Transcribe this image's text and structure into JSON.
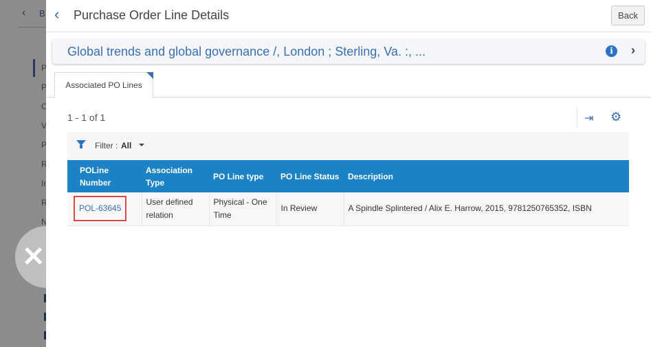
{
  "background": {
    "back_label": "B",
    "letters": [
      "P",
      "P",
      "C",
      "V",
      "P",
      "R",
      "In",
      "R",
      "N"
    ]
  },
  "close_overlay": {
    "glyph": "✕"
  },
  "header": {
    "title": "Purchase Order Line Details",
    "back_button": "Back"
  },
  "record": {
    "title": "Global trends and global governance /, London ; Sterling, Va. :, ..."
  },
  "tabs": [
    {
      "label": "Associated PO Lines",
      "active": true
    }
  ],
  "results": {
    "count_text": "1 - 1 of 1"
  },
  "filter": {
    "label": "Filter :",
    "value": "All"
  },
  "table": {
    "columns": [
      "POLine Number",
      "Association Type",
      "PO Line type",
      "PO Line Status",
      "Description"
    ],
    "rows": [
      {
        "poline_number": "POL-63645",
        "association_type": "User defined relation",
        "po_line_type": "Physical - One Time",
        "po_line_status": "In Review",
        "description": "A Spindle Splintered / Alix E. Harrow, 2015, 9781250765352, ISBN"
      }
    ]
  },
  "colors": {
    "accent": "#3b6fb0",
    "table_header": "#1b82c6",
    "highlight_border": "#e04444"
  }
}
